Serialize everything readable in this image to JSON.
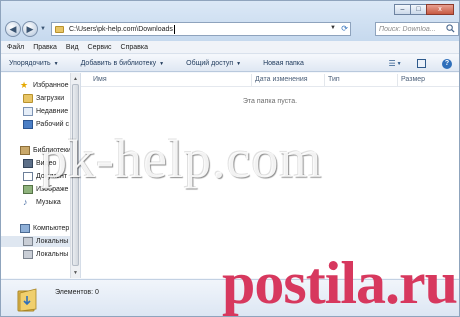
{
  "titlebar": {
    "address_path": "C:\\Users\\pk-help.com\\Downloads",
    "search_placeholder": "Поиск: Downloa...",
    "controls": {
      "minimize": "–",
      "maximize": "□",
      "close": "x"
    }
  },
  "menu": [
    "Файл",
    "Правка",
    "Вид",
    "Сервис",
    "Справка"
  ],
  "toolbar": {
    "organize": "Упорядочить",
    "add_to_library": "Добавить в библиотеку",
    "share": "Общий доступ",
    "new_folder": "Новая папка"
  },
  "nav": {
    "favorites": "Избранное",
    "downloads": "Загрузки",
    "recent": "Недавние",
    "desktop": "Рабочий с",
    "libraries": "Библиотеки",
    "video": "Видео",
    "documents": "Документ",
    "pictures": "Изображе",
    "music": "Музыка",
    "computer": "Компьютер",
    "local1": "Локальны",
    "local2": "Локальны"
  },
  "columns": {
    "name": "Имя",
    "date": "Дата изменения",
    "type": "Тип",
    "size": "Размер"
  },
  "content": {
    "empty_message": "Эта папка пуста."
  },
  "status": {
    "items": "Элементов: 0"
  },
  "watermark": {
    "main": "pk-help.com",
    "brand": "postila.ru"
  },
  "icons": {
    "favorites": "star-icon",
    "downloads": "downloads-folder-icon",
    "recent": "recent-places-icon",
    "desktop": "desktop-icon",
    "libraries": "library-icon",
    "video": "video-library-icon",
    "documents": "documents-library-icon",
    "pictures": "pictures-library-icon",
    "music": "music-library-icon",
    "computer": "computer-icon",
    "drive": "hard-drive-icon",
    "search": "search-icon",
    "help": "help-icon",
    "refresh": "refresh-icon"
  },
  "colors": {
    "brand_watermark": "#d7385e",
    "selection": "#dfe7f1"
  }
}
